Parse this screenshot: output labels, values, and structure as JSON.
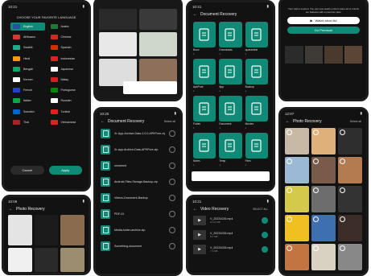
{
  "colors": {
    "accent": "#0f8a76",
    "bg": "#121212"
  },
  "language": {
    "time": "10:21",
    "heading": "CHOOSE YOUR FAVORITE LANGUAGE",
    "items": [
      "English",
      "Arabic",
      "Afrikaans",
      "Chinese",
      "Swahili",
      "Spanish",
      "Hindi",
      "Indonesian",
      "Bengali",
      "Japanese",
      "Korean",
      "Malay",
      "French",
      "Portuguese",
      "Italian",
      "Russian",
      "Swedish",
      "Turkish",
      "Thai",
      "Vietnamese"
    ],
    "selected": 0,
    "cancel": "Cancel",
    "apply": "Apply"
  },
  "doc_recovery_top": {
    "time": "10:21",
    "title": "Document Recovery",
    "folders": [
      {
        "name": "Boox",
        "count": "1"
      },
      {
        "name": "Downloads",
        "count": "1"
      },
      {
        "name": "quarantine",
        "count": "1"
      },
      {
        "name": "ApkPure",
        "count": "1"
      },
      {
        "name": "App",
        "count": "1"
      },
      {
        "name": "Backup",
        "count": "1"
      },
      {
        "name": "Folder",
        "count": "1"
      },
      {
        "name": "Document",
        "count": "1"
      },
      {
        "name": "Movies",
        "count": "1"
      },
      {
        "name": "Notes",
        "count": "1"
      },
      {
        "name": "Temp",
        "count": "1"
      },
      {
        "name": "Files",
        "count": "1"
      }
    ]
  },
  "doc_recovery_list": {
    "time": "10:20",
    "title": "Document Recovery",
    "select_all": "Select all",
    "files": [
      "Xr-App-Archive-Data-1.0.0.APKPure.zip",
      "Xr-app-Archive-Data-APKPure.zip",
      "unnamed",
      "Android-Files-Storage-Backup.zip",
      "Videos-Document-Backup",
      "PDF-01",
      "Media-folder-archive.zip",
      "Something-document"
    ]
  },
  "video_recovery": {
    "time": "10:21",
    "title": "Video Recovery",
    "select_all": "SELECT ALL",
    "items": [
      {
        "name": "V_20231026.mp4",
        "size": "10.11 MB"
      },
      {
        "name": "V_20231026.mp4",
        "size": "8.4 MB"
      },
      {
        "name": "V_20231026.mp4",
        "size": "7.4 MB"
      }
    ]
  },
  "photo_recovery_bottom": {
    "time": "10:06",
    "title": "Photo Recovery"
  },
  "photo_recovery_right": {
    "time": "12:07",
    "title": "Photo Recovery",
    "select_all": "Select all"
  },
  "premium": {
    "text": "Your trial is expired. You can now watch a short video ad or unlock our features with a premium plan.",
    "watch": "Watch short Ad",
    "premium": "Go Premium"
  }
}
